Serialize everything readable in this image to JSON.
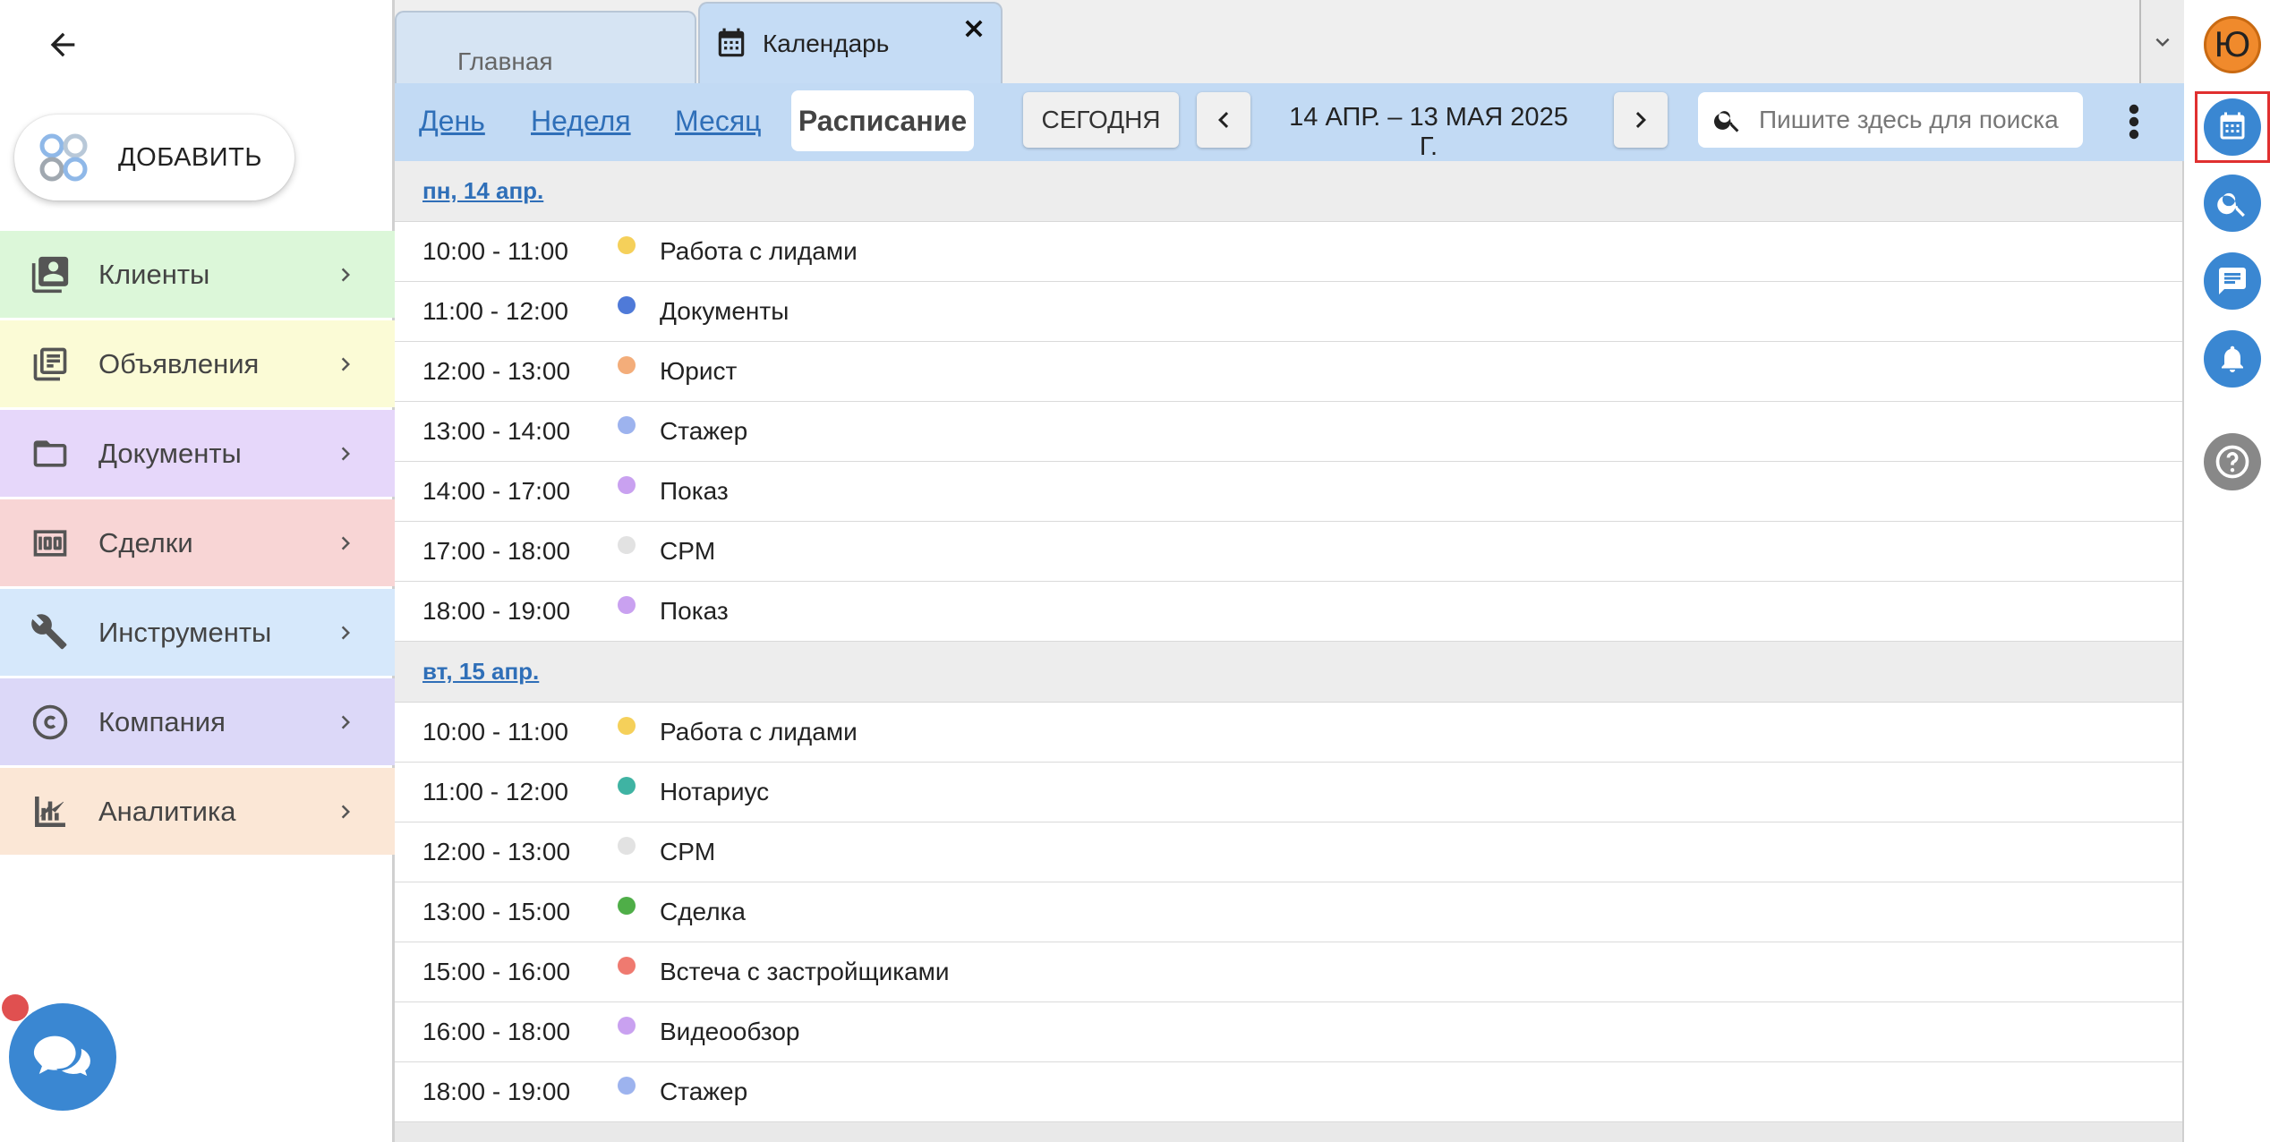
{
  "sidebar": {
    "add_label": "ДОБАВИТЬ",
    "items": [
      {
        "label": "Клиенты",
        "icon": "contacts-icon",
        "bg": "#dcf7d9"
      },
      {
        "label": "Объявления",
        "icon": "listings-icon",
        "bg": "#fbfbd6"
      },
      {
        "label": "Документы",
        "icon": "folder-icon",
        "bg": "#e6d7fa"
      },
      {
        "label": "Сделки",
        "icon": "money-icon",
        "bg": "#f8d5d5"
      },
      {
        "label": "Инструменты",
        "icon": "tools-icon",
        "bg": "#d6e8fb"
      },
      {
        "label": "Компания",
        "icon": "copyright-icon",
        "bg": "#dcd8f8"
      },
      {
        "label": "Аналитика",
        "icon": "analytics-icon",
        "bg": "#fbe7d6"
      }
    ]
  },
  "tabs": {
    "home": "Главная",
    "calendar": "Календарь"
  },
  "toolbar": {
    "views": [
      "День",
      "Неделя",
      "Месяц",
      "Расписание"
    ],
    "active_view": "Расписание",
    "today": "СЕГОДНЯ",
    "range": "14 АПР. – 13 МАЯ 2025 Г.",
    "search_placeholder": "Пишите здесь для поиска"
  },
  "schedule": {
    "days": [
      {
        "header": "пн, 14 апр.",
        "events": [
          {
            "time": "10:00 - 11:00",
            "title": "Работа с лидами",
            "color": "#f5d05a"
          },
          {
            "time": "11:00 - 12:00",
            "title": "Документы",
            "color": "#4f7ad8"
          },
          {
            "time": "12:00 - 13:00",
            "title": "Юрист",
            "color": "#f3ad7a"
          },
          {
            "time": "13:00 - 14:00",
            "title": "Стажер",
            "color": "#9db3ee"
          },
          {
            "time": "14:00 - 17:00",
            "title": "Показ",
            "color": "#c9a1f0"
          },
          {
            "time": "17:00 - 18:00",
            "title": "CPM",
            "color": "#e2e2e2"
          },
          {
            "time": "18:00 - 19:00",
            "title": "Показ",
            "color": "#c9a1f0"
          }
        ]
      },
      {
        "header": "вт, 15 апр.",
        "events": [
          {
            "time": "10:00 - 11:00",
            "title": "Работа с лидами",
            "color": "#f5d05a"
          },
          {
            "time": "11:00 - 12:00",
            "title": "Нотариус",
            "color": "#3fb3a3"
          },
          {
            "time": "12:00 - 13:00",
            "title": "CPM",
            "color": "#e2e2e2"
          },
          {
            "time": "13:00 - 15:00",
            "title": "Сделка",
            "color": "#4fae48"
          },
          {
            "time": "15:00 - 16:00",
            "title": "Встеча с застройщиками",
            "color": "#ef7a70"
          },
          {
            "time": "16:00 - 18:00",
            "title": "Видеообзор",
            "color": "#c9a1f0"
          },
          {
            "time": "18:00 - 19:00",
            "title": "Стажер",
            "color": "#9db3ee"
          }
        ]
      }
    ]
  },
  "rail": {
    "avatar_letter": "Ю",
    "buttons": [
      "calendar-icon",
      "search-icon",
      "chat-icon",
      "bell-icon",
      "help-icon"
    ]
  },
  "colors": {
    "accent": "#3a87d2",
    "toolbar_bg": "#c2daf4",
    "link": "#2f6fb8",
    "highlight_frame": "#e03030"
  }
}
